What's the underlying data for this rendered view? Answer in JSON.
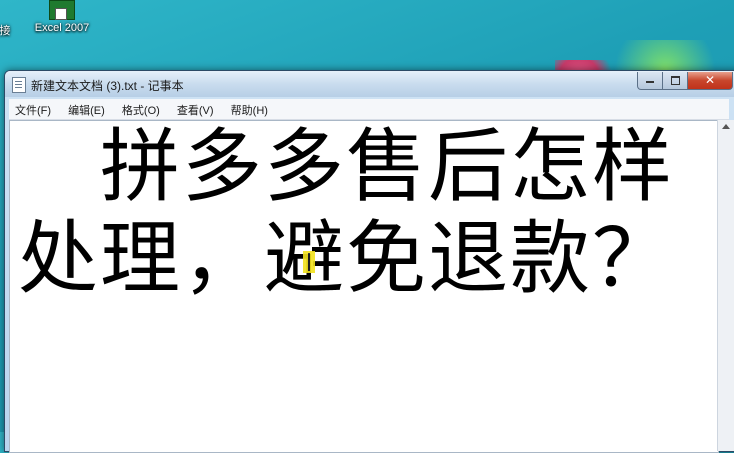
{
  "desktop": {
    "icons": [
      {
        "label": "接"
      },
      {
        "label": "Excel 2007"
      }
    ]
  },
  "window": {
    "title": "新建文本文档 (3).txt - 记事本",
    "controls": {
      "minimize": "minimize",
      "maximize": "maximize",
      "close": "✕"
    }
  },
  "menu": {
    "items": [
      {
        "label": "文件(F)"
      },
      {
        "label": "编辑(E)"
      },
      {
        "label": "格式(O)"
      },
      {
        "label": "查看(V)"
      },
      {
        "label": "帮助(H)"
      }
    ]
  },
  "editor": {
    "content": "　拼多多售后怎样处理，避免退款？"
  }
}
